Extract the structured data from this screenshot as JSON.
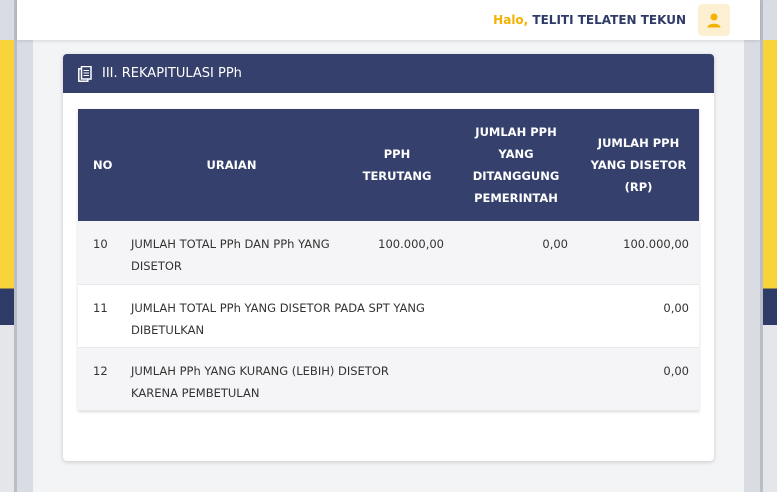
{
  "topbar": {
    "greeting": "Halo,",
    "user_name": "TELITI TELATEN TEKUN"
  },
  "section": {
    "title": "III. REKAPITULASI PPh"
  },
  "table": {
    "headers": {
      "no": "NO",
      "uraian": "URAIAN",
      "pph_terutang": "PPH TERUTANG",
      "pph_ditanggung": "JUMLAH PPH YANG DITANGGUNG PEMERINTAH",
      "pph_disetor": "JUMLAH PPH YANG DISETOR (RP)"
    },
    "rows": [
      {
        "no": "10",
        "uraian": "JUMLAH TOTAL PPh DAN PPh YANG DISETOR",
        "terutang": "100.000,00",
        "ditanggung": "0,00",
        "disetor": "100.000,00"
      },
      {
        "no": "11",
        "uraian": "JUMLAH TOTAL PPh YANG DISETOR PADA SPT YANG DIBETULKAN",
        "terutang": "",
        "ditanggung": "",
        "disetor": "0,00"
      },
      {
        "no": "12",
        "uraian": "JUMLAH PPh YANG KURANG (LEBIH) DISETOR KARENA PEMBETULAN",
        "terutang": "",
        "ditanggung": "",
        "disetor": "0,00"
      }
    ]
  },
  "icons": {
    "avatar": "user-icon",
    "header": "document-copy-icon"
  },
  "colors": {
    "header_navy": "#35406d",
    "greeting_yellow": "#f3b200",
    "banner_yellow": "#f8d33a"
  }
}
